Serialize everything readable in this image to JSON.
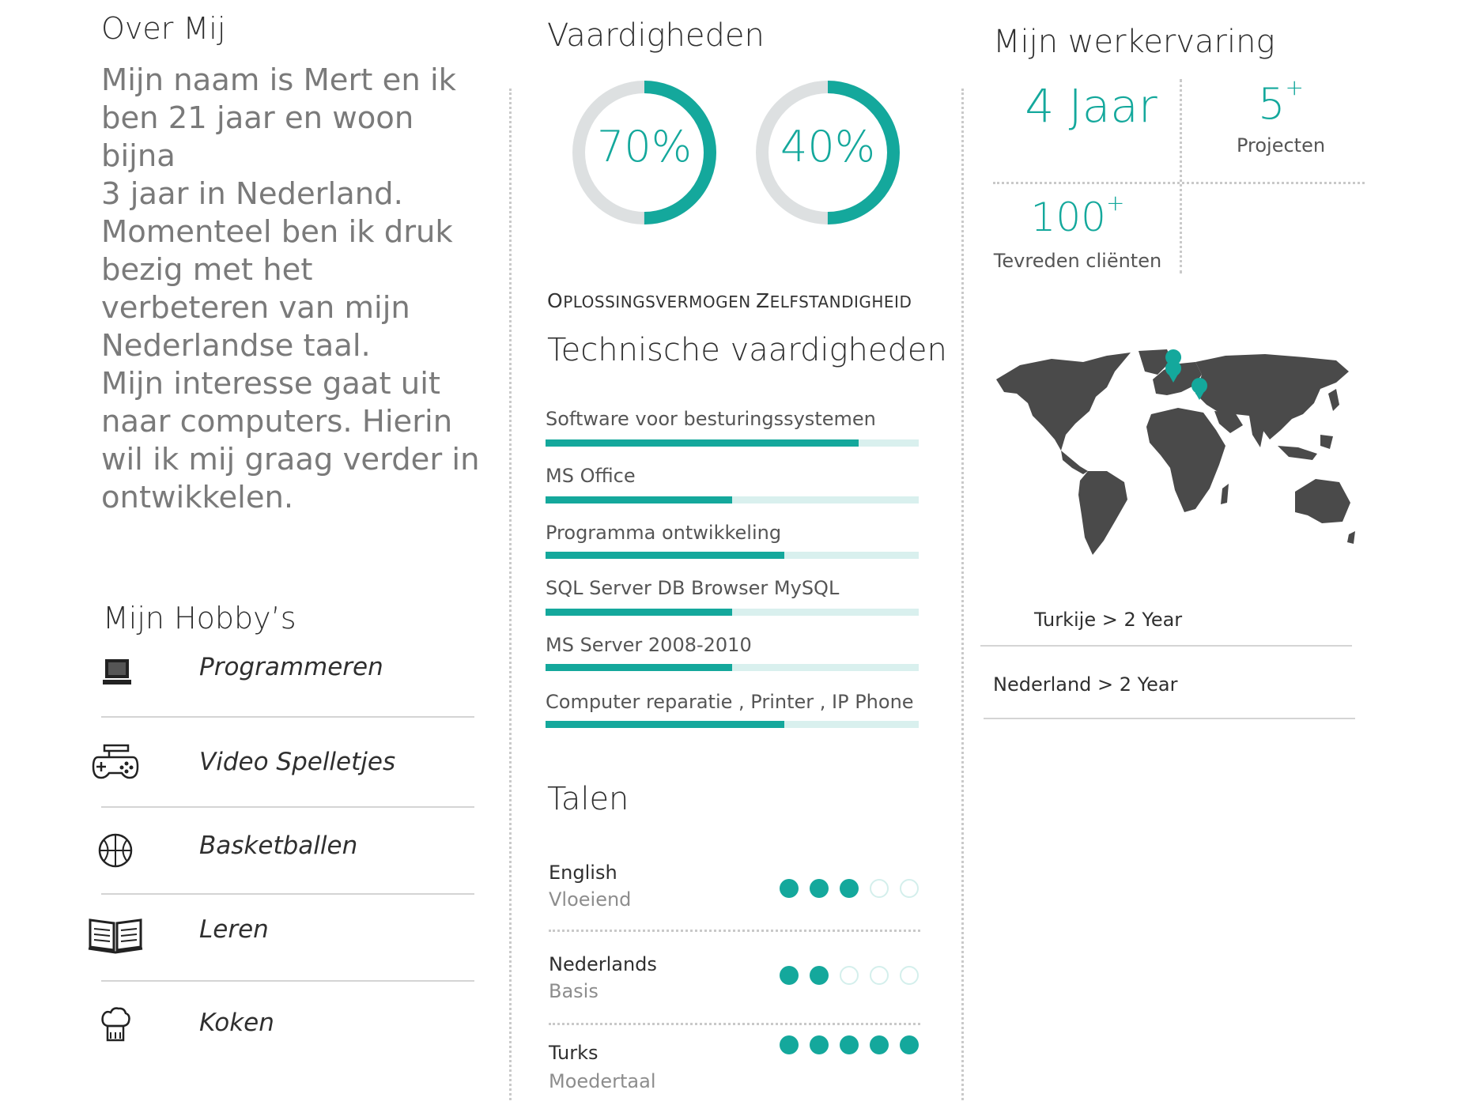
{
  "colors": {
    "accent": "#14a89c",
    "track": "#d9f0ee",
    "ring_bg": "#dde0e1",
    "map": "#4a4a4a"
  },
  "about": {
    "title": "Over Mij",
    "lines": [
      "Mijn naam is Mert en ik",
      "ben 21 jaar en woon bijna",
      "3 jaar in Nederland.",
      "Momenteel ben ik druk",
      "bezig met het",
      "verbeteren van mijn",
      "Nederlandse taal.",
      "Mijn interesse gaat uit",
      "naar computers. Hierin",
      "wil ik mij graag verder in",
      "ontwikkelen."
    ]
  },
  "hobbies": {
    "title": "Mijn Hobby’s",
    "items": [
      {
        "label": "Programmeren",
        "icon": "laptop-icon"
      },
      {
        "label": "Video Spelletjes",
        "icon": "gamepad-icon"
      },
      {
        "label": "Basketballen",
        "icon": "basketball-icon"
      },
      {
        "label": "Leren",
        "icon": "book-icon"
      },
      {
        "label": "Koken",
        "icon": "chef-hat-icon"
      }
    ]
  },
  "skills": {
    "title": "Vaardigheden",
    "donuts": [
      {
        "value": "70%",
        "fraction": 0.5,
        "caption_first": "O",
        "caption_rest": "plossingsvermogen"
      },
      {
        "value": "40%",
        "fraction": 0.5,
        "caption_first": "Z",
        "caption_rest": "elfstandigheid"
      }
    ]
  },
  "technical": {
    "title": "Technische vaardigheden",
    "bars": [
      {
        "label": "Software voor besturingssystemen",
        "level": 0.84
      },
      {
        "label": "MS Office",
        "level": 0.5
      },
      {
        "label": "Programma ontwikkeling",
        "level": 0.64
      },
      {
        "label": "SQL Server DB Browser MySQL",
        "level": 0.5
      },
      {
        "label": "MS Server 2008-2010",
        "level": 0.5
      },
      {
        "label": "Computer reparatie , Printer , IP Phone",
        "level": 0.64
      }
    ]
  },
  "languages": {
    "title": "Talen",
    "items": [
      {
        "name": "English",
        "level_text": "Vloeiend",
        "dots": 3
      },
      {
        "name": "Nederlands",
        "level_text": "Basis",
        "dots": 2
      },
      {
        "name": "Turks",
        "level_text": "Moedertaal",
        "dots": 5
      }
    ]
  },
  "work": {
    "title": "Mijn werkervaring",
    "years": "4 Jaar",
    "projects_num": "5",
    "projects_sup": "+",
    "projects_label": "Projecten",
    "clients_num": "100",
    "clients_sup": "+",
    "clients_label": "Tevreden cliënten",
    "countries": [
      "Turkije > 2 Year",
      "Nederland > 2 Year"
    ]
  }
}
